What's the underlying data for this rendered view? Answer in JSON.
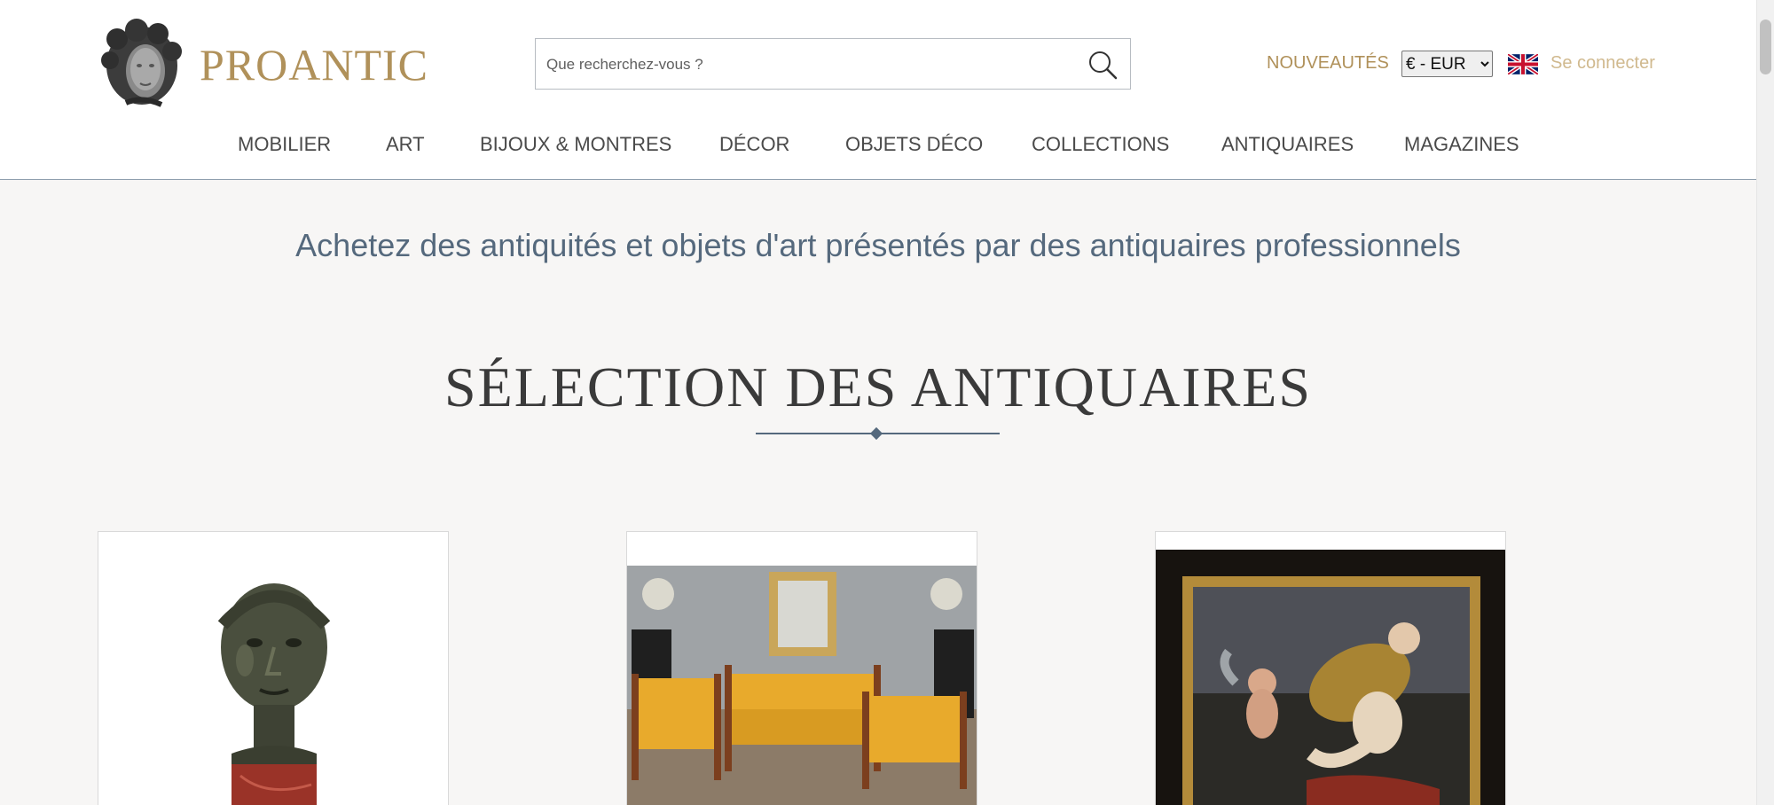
{
  "brand": {
    "name": "PROANTIC",
    "logo_icon": "sculpted-head-logo-icon",
    "color": "#b0915a"
  },
  "search": {
    "placeholder": "Que recherchez-vous ?",
    "icon": "search-icon"
  },
  "header_links": {
    "nouveautes": "NOUVEAUTÉS",
    "login": "Se connecter",
    "language_icon": "uk-flag-icon"
  },
  "currency": {
    "selected": "€ - EUR",
    "options": [
      "€ - EUR"
    ]
  },
  "nav": {
    "items": [
      {
        "label": "MOBILIER"
      },
      {
        "label": "ART"
      },
      {
        "label": "BIJOUX & MONTRES"
      },
      {
        "label": "DÉCOR"
      },
      {
        "label": "OBJETS DÉCO"
      },
      {
        "label": "COLLECTIONS"
      },
      {
        "label": "ANTIQUAIRES"
      },
      {
        "label": "MAGAZINES"
      }
    ]
  },
  "main": {
    "tagline": "Achetez des antiquités et objets d'art présentés par des antiquaires professionnels",
    "section_title": "SÉLECTION DES ANTIQUAIRES"
  },
  "cards": [
    {
      "image": "bronze-head-sculpture-image"
    },
    {
      "image": "empire-salon-furniture-image"
    },
    {
      "image": "framed-baroque-painting-image"
    }
  ],
  "colors": {
    "accent": "#b0915a",
    "text_blue": "#55697d",
    "background": "#f7f6f5"
  }
}
